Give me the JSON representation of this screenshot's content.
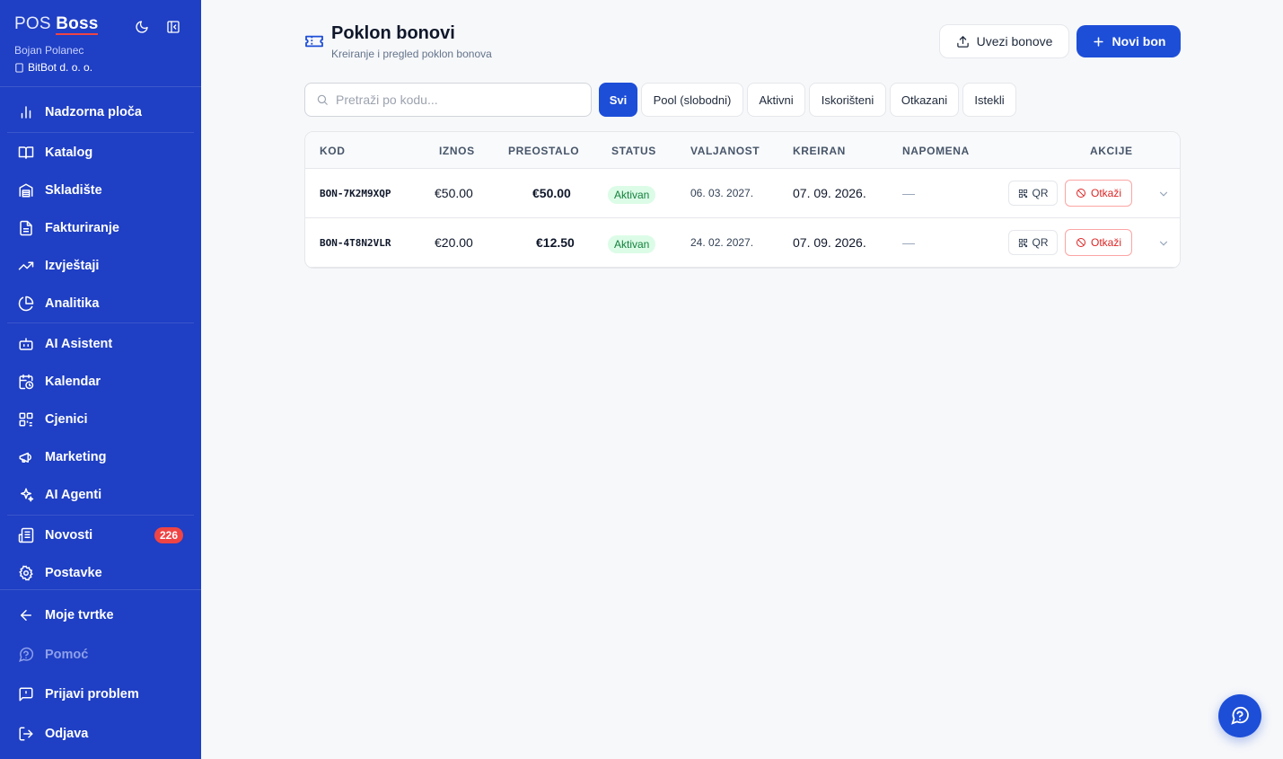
{
  "sidebar": {
    "brand_pos": "POS",
    "brand_boss": "Boss",
    "user_name": "Bojan Polanec",
    "company": "BitBot d. o. o.",
    "items": [
      {
        "label": "Nadzorna ploča",
        "icon": "bar-chart-icon"
      },
      {
        "label": "Katalog",
        "icon": "book-icon"
      },
      {
        "label": "Skladište",
        "icon": "warehouse-icon"
      },
      {
        "label": "Fakturiranje",
        "icon": "document-icon"
      },
      {
        "label": "Izvještaji",
        "icon": "trending-up-icon"
      },
      {
        "label": "Analitika",
        "icon": "pie-chart-icon"
      },
      {
        "label": "AI Asistent",
        "icon": "bot-icon"
      },
      {
        "label": "Kalendar",
        "icon": "calendar-clock-icon"
      },
      {
        "label": "Cjenici",
        "icon": "qr-code-icon"
      },
      {
        "label": "Marketing",
        "icon": "megaphone-icon"
      },
      {
        "label": "AI Agenti",
        "icon": "sparkles-icon"
      },
      {
        "label": "Novosti",
        "icon": "newspaper-icon",
        "badge": "226"
      },
      {
        "label": "Postavke",
        "icon": "gear-icon"
      },
      {
        "label": "Moje tvrtke",
        "icon": "arrow-left-icon"
      },
      {
        "label": "Pomoć",
        "icon": "help-circle-icon"
      },
      {
        "label": "Prijavi problem",
        "icon": "message-square-icon"
      },
      {
        "label": "Odjava",
        "icon": "logout-icon"
      }
    ]
  },
  "header": {
    "title": "Poklon bonovi",
    "subtitle": "Kreiranje i pregled poklon bonova",
    "import_label": "Uvezi bonove",
    "new_label": "Novi bon"
  },
  "search": {
    "placeholder": "Pretraži po kodu...",
    "value": ""
  },
  "filters": [
    {
      "label": "Svi",
      "active": true
    },
    {
      "label": "Pool (slobodni)"
    },
    {
      "label": "Aktivni"
    },
    {
      "label": "Iskorišteni"
    },
    {
      "label": "Otkazani"
    },
    {
      "label": "Istekli"
    }
  ],
  "table": {
    "columns": [
      "KOD",
      "IZNOS",
      "PREOSTALO",
      "STATUS",
      "VALJANOST",
      "KREIRAN",
      "NAPOMENA",
      "AKCIJE"
    ],
    "rows": [
      {
        "code": "BON-7K2M9XQP",
        "amount": "€50.00",
        "remaining": "€50.00",
        "status": "Aktivan",
        "valid": "06. 03. 2027.",
        "created": "07. 09. 2026.",
        "note": "—",
        "qr": "QR",
        "cancel": "Otkaži"
      },
      {
        "code": "BON-4T8N2VLR",
        "amount": "€20.00",
        "remaining": "€12.50",
        "status": "Aktivan",
        "valid": "24. 02. 2027.",
        "created": "07. 09. 2026.",
        "note": "—",
        "qr": "QR",
        "cancel": "Otkaži"
      }
    ]
  },
  "colors": {
    "sidebar": "#1f3fc4",
    "accent": "#1d4ed8",
    "status_active_bg": "#dcfce7",
    "danger": "#dc2626"
  }
}
